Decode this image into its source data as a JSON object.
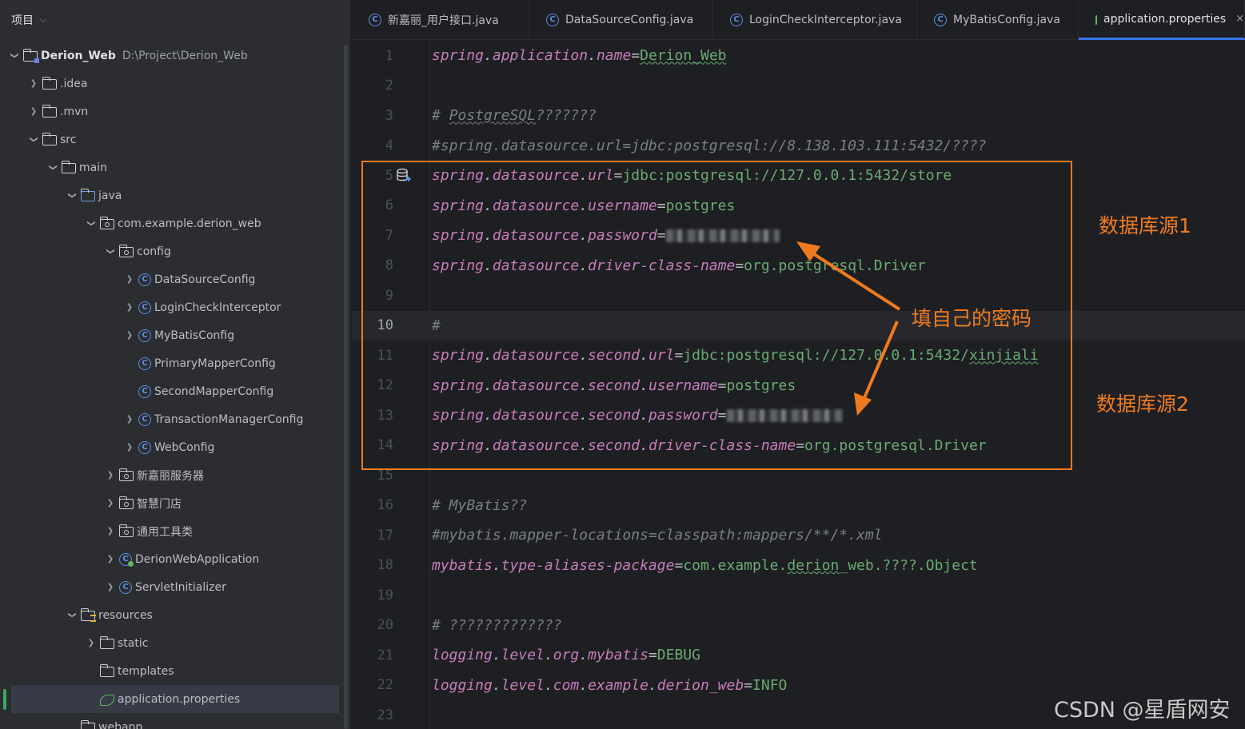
{
  "panel": {
    "title": "项目"
  },
  "tree": [
    {
      "label": "Derion_Web",
      "path": "D:\\Project\\Derion_Web",
      "icon": "module-folder-icon",
      "depth": 0,
      "arrow": "open",
      "bold": true
    },
    {
      "label": ".idea",
      "icon": "folder-icon",
      "depth": 1,
      "arrow": "closed"
    },
    {
      "label": ".mvn",
      "icon": "folder-icon",
      "depth": 1,
      "arrow": "closed"
    },
    {
      "label": "src",
      "icon": "folder-icon",
      "depth": 1,
      "arrow": "open"
    },
    {
      "label": "main",
      "icon": "folder-icon",
      "depth": 2,
      "arrow": "open"
    },
    {
      "label": "java",
      "icon": "source-folder-icon",
      "depth": 3,
      "arrow": "open"
    },
    {
      "label": "com.example.derion_web",
      "icon": "package-icon",
      "depth": 4,
      "arrow": "open"
    },
    {
      "label": "config",
      "icon": "package-icon",
      "depth": 5,
      "arrow": "open"
    },
    {
      "label": "DataSourceConfig",
      "icon": "class-icon",
      "depth": 6,
      "arrow": "closed"
    },
    {
      "label": "LoginCheckInterceptor",
      "icon": "class-icon",
      "depth": 6,
      "arrow": "closed"
    },
    {
      "label": "MyBatisConfig",
      "icon": "class-icon",
      "depth": 6,
      "arrow": "closed"
    },
    {
      "label": "PrimaryMapperConfig",
      "icon": "class-icon",
      "depth": 6,
      "arrow": "none"
    },
    {
      "label": "SecondMapperConfig",
      "icon": "class-icon",
      "depth": 6,
      "arrow": "none"
    },
    {
      "label": "TransactionManagerConfig",
      "icon": "class-icon",
      "depth": 6,
      "arrow": "closed"
    },
    {
      "label": "WebConfig",
      "icon": "class-icon",
      "depth": 6,
      "arrow": "closed"
    },
    {
      "label": "新嘉丽服务器",
      "icon": "package-icon",
      "depth": 5,
      "arrow": "closed"
    },
    {
      "label": "智慧门店",
      "icon": "package-icon",
      "depth": 5,
      "arrow": "closed"
    },
    {
      "label": "通用工具类",
      "icon": "package-icon",
      "depth": 5,
      "arrow": "closed"
    },
    {
      "label": "DerionWebApplication",
      "icon": "spring-app-icon",
      "depth": 5,
      "arrow": "closed"
    },
    {
      "label": "ServletInitializer",
      "icon": "class-icon",
      "depth": 5,
      "arrow": "closed"
    },
    {
      "label": "resources",
      "icon": "resources-folder-icon",
      "depth": 3,
      "arrow": "open"
    },
    {
      "label": "static",
      "icon": "folder-icon",
      "depth": 4,
      "arrow": "closed"
    },
    {
      "label": "templates",
      "icon": "folder-icon",
      "depth": 4,
      "arrow": "none"
    },
    {
      "label": "application.properties",
      "icon": "spring-properties-icon",
      "depth": 4,
      "arrow": "none",
      "selected": true
    },
    {
      "label": "webapp",
      "icon": "folder-icon",
      "depth": 3,
      "arrow": "none"
    }
  ],
  "tabs": [
    {
      "label": "新嘉丽_用户接口.java",
      "icon": "class-icon"
    },
    {
      "label": "DataSourceConfig.java",
      "icon": "class-icon"
    },
    {
      "label": "LoginCheckInterceptor.java",
      "icon": "class-icon"
    },
    {
      "label": "MyBatisConfig.java",
      "icon": "class-icon"
    },
    {
      "label": "application.properties",
      "icon": "spring-properties-icon",
      "active": true,
      "close": "×"
    }
  ],
  "editor": {
    "current_line": 10,
    "lines": [
      {
        "n": "1",
        "type": "prop",
        "key": "spring.application.name",
        "value": "Derion_Web",
        "value_squiggle": true
      },
      {
        "n": "2",
        "type": "blank"
      },
      {
        "n": "3",
        "type": "comment",
        "pre": "# ",
        "word": "PostgreSQL",
        "post": "???????"
      },
      {
        "n": "4",
        "type": "comment",
        "text": "#spring.datasource.url=jdbc:postgresql://8.138.103.111:5432/????"
      },
      {
        "n": "5",
        "type": "prop",
        "key": "spring.datasource.url",
        "value": "jdbc:postgresql://127.0.0.1:5432/store"
      },
      {
        "n": "6",
        "type": "prop",
        "key": "spring.datasource.username",
        "value": "postgres"
      },
      {
        "n": "7",
        "type": "prop",
        "key": "spring.datasource.password",
        "value": "",
        "masked": true
      },
      {
        "n": "8",
        "type": "prop",
        "key": "spring.datasource.driver-class-name",
        "value": "org.postgresql.Driver"
      },
      {
        "n": "9",
        "type": "blank"
      },
      {
        "n": "10",
        "type": "comment",
        "text": "#"
      },
      {
        "n": "11",
        "type": "prop",
        "key": "spring.datasource.second.url",
        "value": "jdbc:postgresql://127.0.0.1:5432/",
        "value_tail": "xinjiali"
      },
      {
        "n": "12",
        "type": "prop",
        "key": "spring.datasource.second.username",
        "value": "postgres"
      },
      {
        "n": "13",
        "type": "prop",
        "key": "spring.datasource.second.password",
        "value": "",
        "masked": true
      },
      {
        "n": "14",
        "type": "prop",
        "key": "spring.datasource.second.driver-class-name",
        "value": "org.postgresql.Driver"
      },
      {
        "n": "15",
        "type": "blank"
      },
      {
        "n": "16",
        "type": "comment",
        "text": "# MyBatis??"
      },
      {
        "n": "17",
        "type": "comment",
        "text": "#mybatis.mapper-locations=classpath:mappers/**/*.xml"
      },
      {
        "n": "18",
        "type": "prop",
        "key": "mybatis.type-aliases-package",
        "value_pre": "com.example.",
        "value_word": "derion",
        "value": "_web.????.Object"
      },
      {
        "n": "19",
        "type": "blank"
      },
      {
        "n": "20",
        "type": "comment",
        "text": "# ?????????????"
      },
      {
        "n": "21",
        "type": "prop",
        "key": "logging.level.org.mybatis",
        "value": "DEBUG"
      },
      {
        "n": "22",
        "type": "prop",
        "key": "logging.level.com.example.derion_web",
        "value": "INFO"
      },
      {
        "n": "23",
        "type": "blank"
      }
    ]
  },
  "annotations": {
    "source1": "数据库源1",
    "source2": "数据库源2",
    "password_hint": "填自己的密码",
    "accent": "#f07b1e"
  },
  "watermark": "CSDN @星盾网安"
}
